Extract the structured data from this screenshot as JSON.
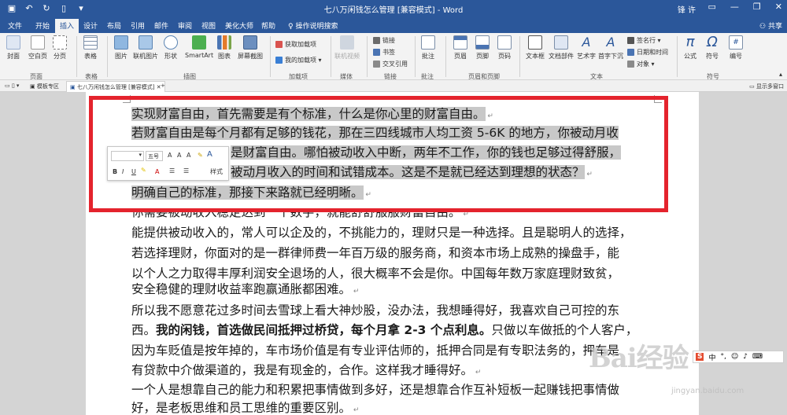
{
  "window": {
    "title": "七八万闲钱怎么管理 [兼容模式] - Word",
    "user": "锋 许",
    "share": "共享"
  },
  "menu_tabs": [
    "文件",
    "开始",
    "插入",
    "设计",
    "布局",
    "引用",
    "邮件",
    "审阅",
    "视图",
    "美化大师",
    "帮助",
    "操作说明搜索"
  ],
  "active_tab": "插入",
  "ribbon": {
    "pages": {
      "cover": "封面",
      "blank": "空白页",
      "break": "分页",
      "group": "页面"
    },
    "tables": {
      "table": "表格",
      "group": "表格"
    },
    "illustrations": {
      "picture": "图片",
      "online_picture": "联机图片",
      "shapes": "形状",
      "smartart": "SmartArt",
      "chart": "图表",
      "screenshot": "屏幕截图",
      "group": "插图"
    },
    "addins": {
      "get": "获取加载项",
      "mine": "我的加载项",
      "group": "加载项"
    },
    "media": {
      "online_video": "联机视频",
      "group": "媒体"
    },
    "links": {
      "link": "链接",
      "bookmark": "书签",
      "crossref": "交叉引用",
      "group": "链接"
    },
    "comments": {
      "comment": "批注",
      "group": "批注"
    },
    "header_footer": {
      "header": "页眉",
      "footer": "页脚",
      "page_number": "页码",
      "group": "页眉和页脚"
    },
    "text": {
      "textbox": "文本框",
      "parts": "文档部件",
      "wordart": "艺术字",
      "dropcap": "首字下沉",
      "signature": "签名行",
      "datetime": "日期和时间",
      "object": "对象",
      "group": "文本"
    },
    "symbols": {
      "equation": "公式",
      "symbol": "符号",
      "number": "编号",
      "group": "符号"
    }
  },
  "doc_tabs": {
    "template": "模板专区",
    "current": "七八万闲钱怎么管理 [兼容模式]",
    "show_all": "显示多窗口"
  },
  "mini_toolbar": {
    "font_size": "五号",
    "styles": "样式"
  },
  "document": {
    "lines": [
      "实现财富自由，首先需要是有个标准，什么是你心里的财富自由。",
      "若财富自由是每个月都有足够的钱花，那在三四线城市人均工资 5-6K 的地方，你被动月收",
      "是财富自由。哪怕被动收入中断，两年不工作，你的钱也足够过得舒服，",
      "被动月收入的时间和试错成本。这是不是就已经达到理想的状态？",
      "明确自己的标准，那接下来路就已经明晰。",
      "你需要被动收入稳定达到一个数字，就能舒舒服服财富自由。",
      "能提供被动收入的，常人可以企及的，不挑能力的，理财只是一种选择。且是聪明人的选择，",
      "若选择理财，你面对的是一群律师费一年百万级的服务商，和资本市场上成熟的操盘手，能",
      "以个人之力取得丰厚利润安全退场的人，很大概率不会是你。中国每年数万家庭理财致贫，",
      "安全稳健的理财收益率跑赢通胀都困难。",
      "所以我不愿意花过多时间去雪球上看大神炒股，没办法，我想睡得好，我喜欢自己可控的东",
      "西。",
      "我的闲钱，首选做民间抵押过桥贷，每个月拿 2-3 个点利息。",
      "只做以车做抵的个人客户，",
      "因为车贬值是按年掉的，车市场价值是有专业评估师的，抵押合同是有专职法务的，押车是",
      "有贷款中介做渠道的，我是有现金的，合作。这样我才睡得好。",
      "一个人是想靠自己的能力和积累把事情做到多好，还是想靠合作互补短板一起赚钱把事情做",
      "好，是老板思维和员工思维的重要区别。"
    ]
  },
  "watermark": {
    "brand": "Bai经验",
    "url": "jingyan.baidu.com"
  },
  "colors": {
    "word_blue": "#2b579a",
    "highlight_box": "#e4232d",
    "selection": "#c8c8c8"
  }
}
